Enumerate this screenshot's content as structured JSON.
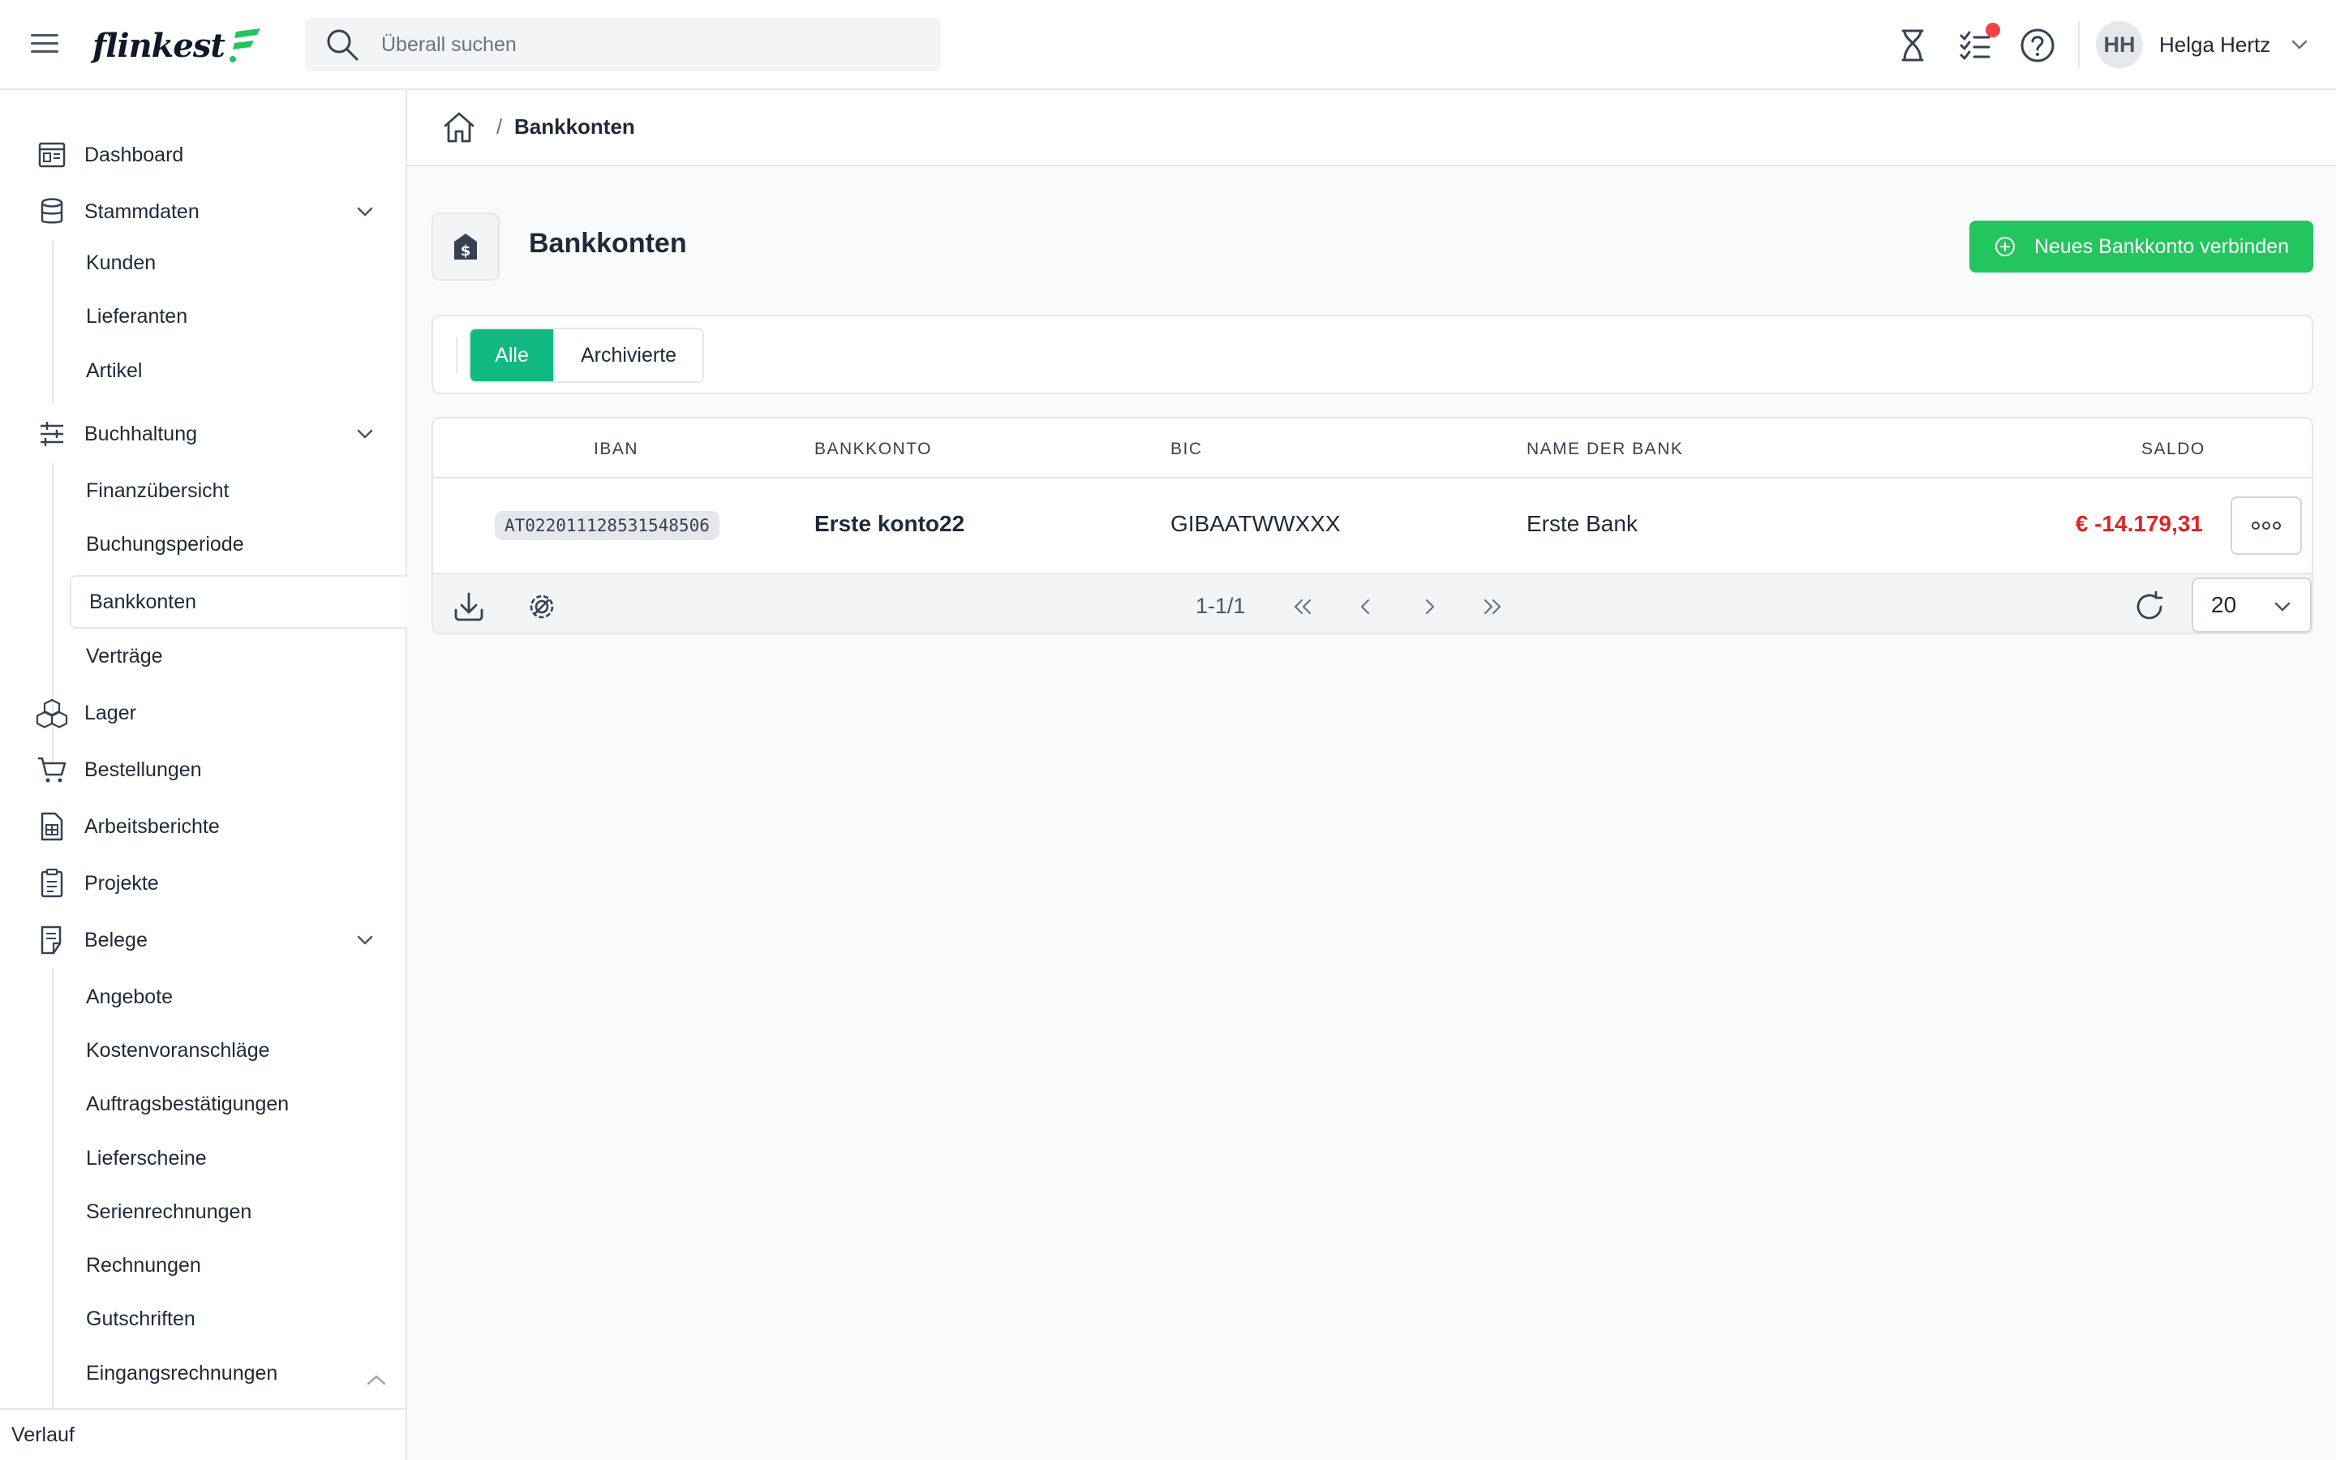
{
  "header": {
    "logo_text": "flinkest",
    "search": {
      "placeholder": "Überall suchen"
    },
    "user": {
      "initials": "HH",
      "name": "Helga Hertz"
    },
    "notification_color": "#ef4444"
  },
  "sidebar": {
    "items": [
      {
        "label": "Dashboard",
        "icon": "dashboard-icon"
      },
      {
        "label": "Stammdaten",
        "icon": "database-icon",
        "expanded": true,
        "children": [
          "Kunden",
          "Lieferanten",
          "Artikel"
        ]
      },
      {
        "label": "Buchhaltung",
        "icon": "sliders-icon",
        "expanded": true,
        "children": [
          "Finanzübersicht",
          "Buchungsperiode",
          "Bankkonten",
          "Verträge"
        ],
        "active_child": "Bankkonten"
      },
      {
        "label": "Lager",
        "icon": "boxes-icon"
      },
      {
        "label": "Bestellungen",
        "icon": "cart-icon"
      },
      {
        "label": "Arbeitsberichte",
        "icon": "report-icon"
      },
      {
        "label": "Projekte",
        "icon": "clipboard-icon"
      },
      {
        "label": "Belege",
        "icon": "receipt-icon",
        "expanded": true,
        "children": [
          "Angebote",
          "Kostenvoranschläge",
          "Auftragsbestätigungen",
          "Lieferscheine",
          "Serienrechnungen",
          "Rechnungen",
          "Gutschriften",
          "Eingangsrechnungen"
        ]
      }
    ],
    "footer_label": "Verlauf"
  },
  "breadcrumb": {
    "separator": "/",
    "current": "Bankkonten"
  },
  "page": {
    "title": "Bankkonten",
    "primary_button": "Neues Bankkonto verbinden",
    "accent_color": "#22c55e"
  },
  "filters": {
    "tabs": [
      "Alle",
      "Archivierte"
    ],
    "active": "Alle"
  },
  "table": {
    "columns": [
      "IBAN",
      "BANKKONTO",
      "BIC",
      "NAME DER BANK",
      "SALDO"
    ],
    "rows": [
      {
        "iban": "AT022011128531548506",
        "bankkonto": "Erste konto22",
        "bic": "GIBAATWWXXX",
        "bank": "Erste Bank",
        "saldo": "€ -14.179,31"
      }
    ],
    "negative_color": "#dc2626"
  },
  "pagination": {
    "range": "1-1/1",
    "page_size": "20"
  }
}
